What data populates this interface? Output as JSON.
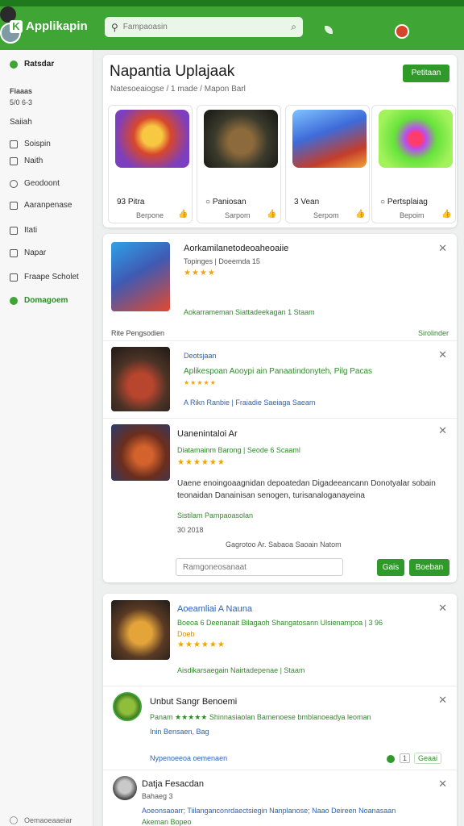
{
  "app": {
    "logo_text": "Applikapin",
    "logo_mark": "K"
  },
  "search": {
    "placeholder": "Fampaoasin",
    "value": ""
  },
  "topbar": {
    "leaf_icon": "leaf-icon",
    "notif_icon": "bell-icon"
  },
  "sidebar": {
    "items": [
      {
        "label": "Ratsdar",
        "kind": "head"
      },
      {
        "label": "Fiasas",
        "kind": "plain"
      },
      {
        "label": "Saiiah",
        "kind": "plain"
      },
      {
        "label": "Soispin",
        "kind": "plain"
      },
      {
        "label": "Naith",
        "kind": "plain"
      },
      {
        "label": "Geodoont",
        "kind": "plain"
      },
      {
        "label": "Aaranpenase",
        "kind": "plain"
      },
      {
        "label": "Itati",
        "kind": "plain"
      },
      {
        "label": "Napar",
        "kind": "plain"
      },
      {
        "label": "Fraape Scholet",
        "kind": "plain"
      },
      {
        "label": "Domagoem",
        "kind": "green"
      }
    ],
    "sub1": "Fiaaas",
    "sub2": "5/0 6-3",
    "bottom": "Oemaoeaaeiar"
  },
  "featured": {
    "title": "Napantia Uplajaak",
    "subtitle": "Natesoeaiogse / 1 made / Mapon Barl",
    "button": "Petitaan",
    "tiles": [
      {
        "name": "Pitra",
        "prefix": "93",
        "sub": "Berpone",
        "art": "art1"
      },
      {
        "name": "Paniosan",
        "prefix": "",
        "sub": "Sarpom",
        "art": "art2"
      },
      {
        "name": "Vean",
        "prefix": "3",
        "sub": "Serpom",
        "art": "art3"
      },
      {
        "name": "Pertsplaiag",
        "prefix": "",
        "sub": "Bepoim",
        "art": "art4"
      }
    ]
  },
  "feed": {
    "bar_left": "Rite  Pengsodien",
    "bar_right": "Sirolinder",
    "items": [
      {
        "name": "Aorkamilanetodeoaheoaiie",
        "meta": "Topinges  |  Doeemda  15",
        "stars": "★★★★",
        "link": "Aokarrameman Siattadeekagan  1 Staam"
      },
      {
        "name": "Deotsjaan",
        "subname": "Aplikespoan Aooypi ain  Panaatindonyteh, Pilg  Pacas",
        "stars": "★★★★★",
        "link": "A Rikn Ranbie  |  Fraiadie Saeiaga  Saeam"
      },
      {
        "name": "Uanenintaloi Ar",
        "meta": "Diatamainm Barong  |  Seode  6 Scaaml",
        "stars": "★★★★★★",
        "desc": "Uaene enoingoaagnidan depoatedan Digadeeancann Donotyalar sobain teonaidan Danainisan senogen, turisanaloganayeina",
        "link": "Sistilam  Pampaoasolan",
        "code": "30 2018",
        "foot": "Gagrotoo Ar. Sabaoa Saoain  Natom",
        "input_placeholder": "Ramgoneosanaat",
        "btn1": "Gais",
        "btn2": "Boeban"
      },
      {
        "name": "Aoeamliai A  Nauna",
        "meta": "Boeoa  6  Deenanait Bilagaoh Shangatosann Ulsienampoa  |  3 96",
        "meta2": "Doeb",
        "stars": "★★★★★★",
        "link": "Aisdikarsaegain Nairtadepenae  |  Staam"
      },
      {
        "name": "Unbut Sangr Benoemi",
        "meta": "Panam ★★★★★ Shinnasiaolan Bamenoese bmblanoeadya leoman",
        "stars": "★★★★★",
        "meta2": "Inin Bensaen,  Bag",
        "link": "Nypenoeeoa oemenaen",
        "reply_btn": "Geaai",
        "count": "1"
      },
      {
        "name": "Datja Fesacdan",
        "meta": "Bahaeg 3",
        "link": "Aoeonsaoarr;  Tiilanganconrdaectsiegin Nanplanose;  Naao Deireen Noanasaan",
        "link2": "Akeman  Bopeo"
      }
    ]
  }
}
